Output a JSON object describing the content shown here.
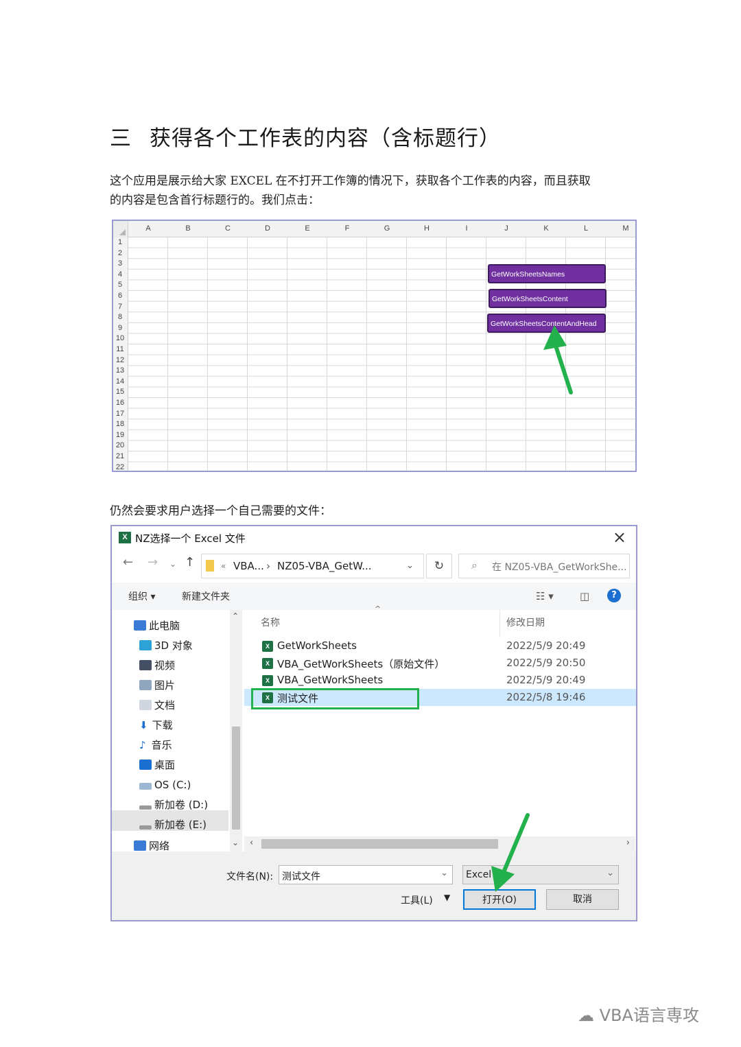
{
  "heading": {
    "number": "三",
    "title": "获得各个工作表的内容（含标题行）"
  },
  "para1_line1": "这个应用是展示给大家 EXCEL 在不打开工作簿的情况下，获取各个工作表的内容，而且获取",
  "para1_line2": "的内容是包含首行标题行的。我们点击：",
  "para2": "仍然会要求用户选择一个自己需要的文件：",
  "sheet": {
    "columns": [
      "A",
      "B",
      "C",
      "D",
      "E",
      "F",
      "G",
      "H",
      "I",
      "J",
      "K",
      "L",
      "M"
    ],
    "rows": [
      "1",
      "2",
      "3",
      "4",
      "5",
      "6",
      "7",
      "8",
      "9",
      "10",
      "11",
      "12",
      "13",
      "14",
      "15",
      "16",
      "17",
      "18",
      "19",
      "20",
      "21",
      "22"
    ],
    "buttons": [
      "GetWorkSheetsNames",
      "GetWorkSheetsContent",
      "GetWorkSheetsContentAndHead"
    ],
    "button_color": "#7030a0"
  },
  "dialog": {
    "title": "NZ选择一个 Excel 文件",
    "address": {
      "more": "«",
      "crumb1": "VBA...",
      "sep": "›",
      "crumb2": "NZ05-VBA_GetW..."
    },
    "search_placeholder": "在 NZ05-VBA_GetWorkShe...",
    "toolbar": {
      "organize": "组织 ▾",
      "new_folder": "新建文件夹"
    },
    "nav_items": [
      "此电脑",
      "3D 对象",
      "视频",
      "图片",
      "文档",
      "下载",
      "音乐",
      "桌面",
      "OS (C:)",
      "新加卷 (D:)",
      "新加卷 (E:)",
      "网络"
    ],
    "columns": {
      "name": "名称",
      "modified": "修改日期"
    },
    "files": [
      {
        "name": "GetWorkSheets",
        "date": "2022/5/9 20:49"
      },
      {
        "name": "VBA_GetWorkSheets（原始文件）",
        "date": "2022/5/9 20:50"
      },
      {
        "name": "VBA_GetWorkSheets",
        "date": "2022/5/9 20:49"
      },
      {
        "name": "测试文件",
        "date": "2022/5/8 19:46"
      }
    ],
    "filename_label": "文件名(N):",
    "filename_value": "测试文件",
    "filetype_value": "Excel F...",
    "tools": "工具(L)",
    "open": "打开(O)",
    "cancel": "取消",
    "highlight_color": "#22b14c"
  },
  "watermark": "VBA语言専攻"
}
